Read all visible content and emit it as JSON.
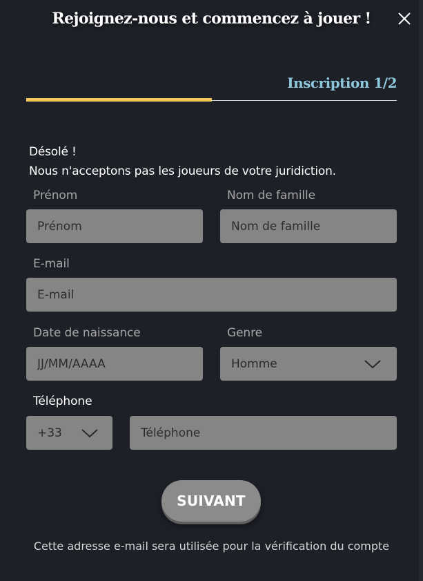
{
  "header": {
    "title": "Rejoignez-nous et commencez à jouer !",
    "step_label": "Inscription 1/2",
    "progress": 0.5
  },
  "notice": {
    "line1": "Désolé !",
    "line2": "Nous n'acceptons pas les joueurs de votre juridiction."
  },
  "form": {
    "first_name": {
      "label": "Prénom",
      "placeholder": "Prénom"
    },
    "last_name": {
      "label": "Nom de famille",
      "placeholder": "Nom de famille"
    },
    "email": {
      "label": "E-mail",
      "placeholder": "E-mail"
    },
    "birthdate": {
      "label": "Date de naissance",
      "placeholder": "JJ/MM/AAAA"
    },
    "gender": {
      "label": "Genre",
      "value": "Homme"
    },
    "phone": {
      "label": "Téléphone",
      "prefix": "+33",
      "placeholder": "Téléphone"
    }
  },
  "actions": {
    "next_label": "SUIVANT"
  },
  "footer": {
    "text": "Cette adresse e-mail sera utilisée pour la vérification du compte"
  },
  "colors": {
    "background": "#1e2028",
    "accent_yellow": "#f4c85a",
    "step_blue": "#8ec8dc",
    "field_gray": "#858585"
  },
  "icons": {
    "close": "close-icon",
    "chevron": "chevron-down-icon"
  }
}
